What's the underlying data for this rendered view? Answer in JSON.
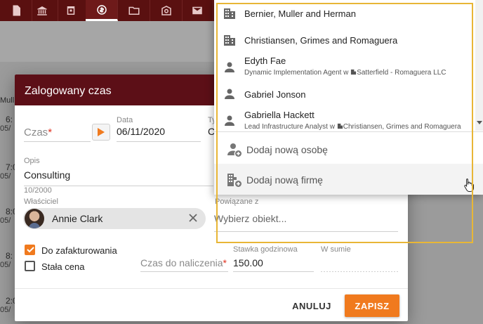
{
  "dialog": {
    "title": "Zalogowany czas",
    "time": {
      "label": "Czas",
      "required_mark": "*"
    },
    "date": {
      "label": "Data",
      "value": "06/11/2020"
    },
    "type": {
      "label": "Ty",
      "value": "C"
    },
    "description": {
      "label": "Opis",
      "value": "Consulting",
      "counter": "10/2000"
    },
    "owner": {
      "label": "Właściciel",
      "name": "Annie Clark"
    },
    "related": {
      "label": "Powiązane z",
      "placeholder": "Wybierz obiekt..."
    },
    "to_invoice": {
      "label": "Do zafakturowania",
      "checked": true
    },
    "fixed_price": {
      "label": "Stała cena",
      "checked": false
    },
    "billable_time": {
      "label": "Czas do naliczenia",
      "required_mark": "*"
    },
    "hourly_rate": {
      "label": "Stawka godzinowa",
      "value": "150.00"
    },
    "total": {
      "label": "W sumie"
    },
    "cancel_label": "ANULUJ",
    "save_label": "ZAPISZ"
  },
  "dropdown": {
    "items": [
      {
        "type": "company",
        "icon": "building-icon",
        "title": "Bernier, Muller and Herman"
      },
      {
        "type": "company",
        "icon": "building-icon",
        "title": "Christiansen, Grimes and Romaguera"
      },
      {
        "type": "person",
        "icon": "person-icon",
        "title": "Edyth Fae",
        "subtitle_role": "Dynamic Implementation Agent w",
        "subtitle_company": "Satterfield - Romaguera LLC"
      },
      {
        "type": "person",
        "icon": "person-icon",
        "title": "Gabriel Jonson"
      },
      {
        "type": "person",
        "icon": "person-icon",
        "title": "Gabriella Hackett",
        "subtitle_role": "Lead Infrastructure Analyst w",
        "subtitle_company": "Christiansen, Grimes and Romaguera"
      }
    ],
    "add_person_label": "Dodaj nową osobę",
    "add_company_label": "Dodaj nową firmę"
  },
  "background": {
    "column_header": "Mull",
    "rows": [
      {
        "time": "6:",
        "date": "05/"
      },
      {
        "time": "7:0",
        "date": "05/"
      },
      {
        "time": "8:0",
        "date": "05/"
      },
      {
        "time": "8:",
        "date": "05/"
      },
      {
        "time": "2:0",
        "date": "05/"
      }
    ]
  },
  "colors": {
    "header": "#5c0f17",
    "accent": "#f07a1e",
    "highlight": "#e8b636"
  }
}
